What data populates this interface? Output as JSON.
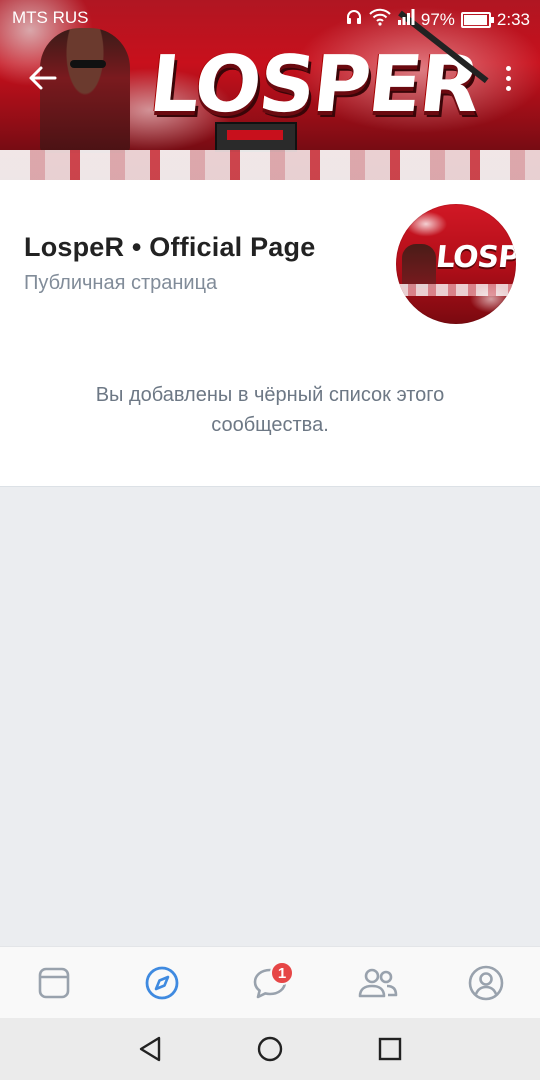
{
  "status_bar": {
    "carrier": "MTS RUS",
    "battery": "97%",
    "time": "2:33"
  },
  "cover": {
    "logo_text": "LOSPER"
  },
  "community": {
    "name": "LospeR • Official Page",
    "type": "Публичная страница",
    "notice": "Вы добавлены в чёрный список этого сообщества."
  },
  "tabbar": {
    "items": [
      {
        "icon": "feed-icon",
        "active": false
      },
      {
        "icon": "explore-icon",
        "active": true
      },
      {
        "icon": "messages-icon",
        "active": false,
        "badge": "1"
      },
      {
        "icon": "friends-icon",
        "active": false
      },
      {
        "icon": "profile-icon",
        "active": false
      }
    ]
  },
  "colors": {
    "accent": "#3f8ae0",
    "inactive_icon": "#99a2ad",
    "badge": "#e64646",
    "secondary_text": "#818c99"
  }
}
